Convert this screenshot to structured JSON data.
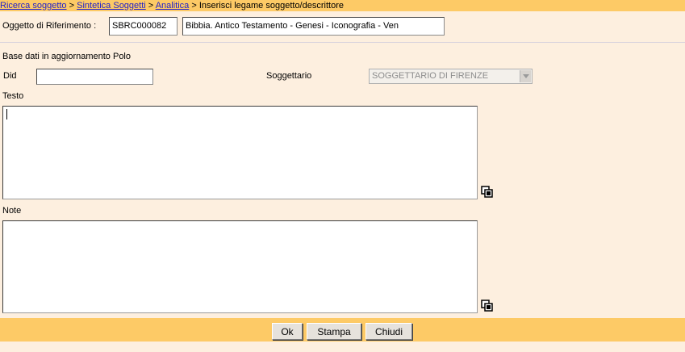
{
  "breadcrumb": {
    "items": [
      "Ricerca soggetto",
      "Sintetica Soggetti",
      "Analitica"
    ],
    "separator": ">",
    "current": "Inserisci legame soggetto/descrittore"
  },
  "reference": {
    "label": "Oggetto di Riferimento :",
    "code": "SBRC000082",
    "description": "Bibbia. Antico Testamento - Genesi - Iconografia - Ven"
  },
  "form": {
    "section_title": "Base dati in aggiornamento Polo",
    "did_label": "Did",
    "did_value": "",
    "soggettario_label": "Soggettario",
    "soggettario_selected": "SOGGETTARIO DI FIRENZE",
    "testo_label": "Testo",
    "testo_value": "",
    "note_label": "Note",
    "note_value": ""
  },
  "buttons": {
    "ok": "Ok",
    "stampa": "Stampa",
    "chiudi": "Chiudi"
  },
  "icons": {
    "testo_action": "copy-icon",
    "note_action": "copy-icon"
  },
  "colors": {
    "bar": "#fdca66",
    "background": "#fdefdf",
    "link": "#1f1fcc"
  }
}
